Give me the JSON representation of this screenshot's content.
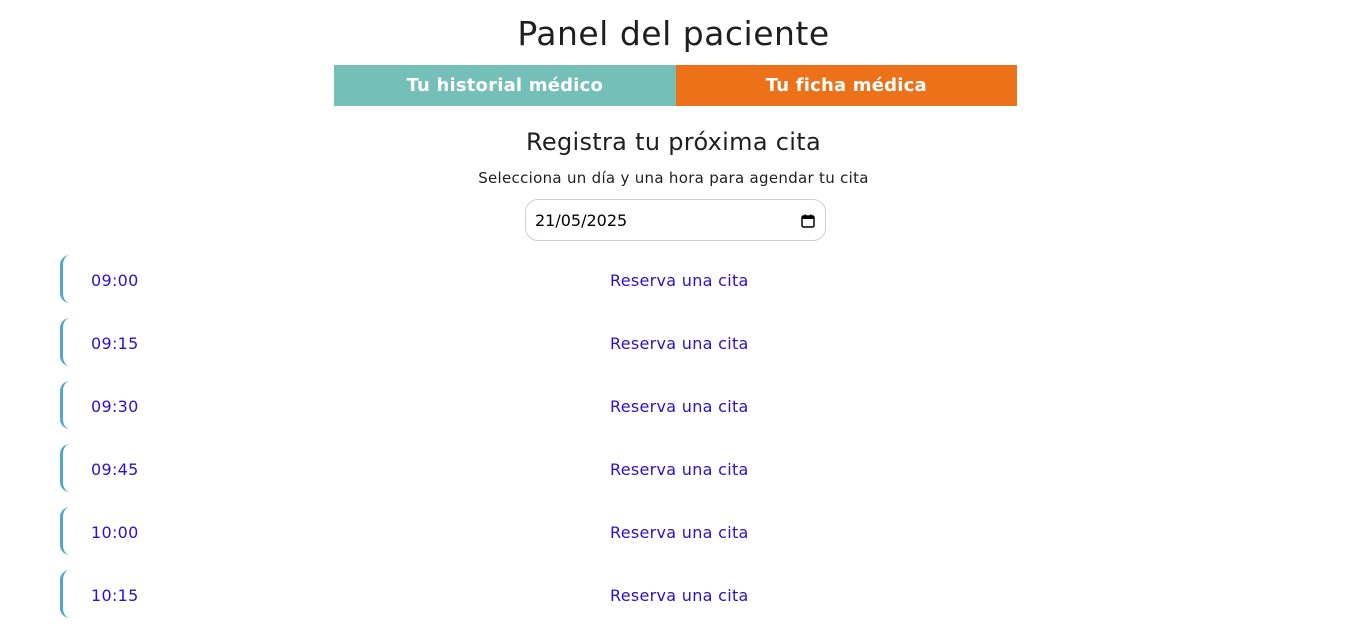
{
  "header": {
    "title": "Panel del paciente"
  },
  "tabs": [
    {
      "label": "Tu historial médico",
      "color": "#74c0b9"
    },
    {
      "label": "Tu ficha médica",
      "color": "#ec7118"
    }
  ],
  "appointment": {
    "title": "Registra tu próxima cita",
    "subtitle": "Selecciona un día y una hora para agendar tu cita",
    "date_value": "21/05/2025",
    "date_icon": "calendar-icon"
  },
  "slots": [
    {
      "time": "09:00",
      "action": "Reserva una cita"
    },
    {
      "time": "09:15",
      "action": "Reserva una cita"
    },
    {
      "time": "09:30",
      "action": "Reserva una cita"
    },
    {
      "time": "09:45",
      "action": "Reserva una cita"
    },
    {
      "time": "10:00",
      "action": "Reserva una cita"
    },
    {
      "time": "10:15",
      "action": "Reserva una cita"
    }
  ],
  "colors": {
    "link": "#2a0fd4",
    "slot_accent": "#4ea7cf"
  }
}
